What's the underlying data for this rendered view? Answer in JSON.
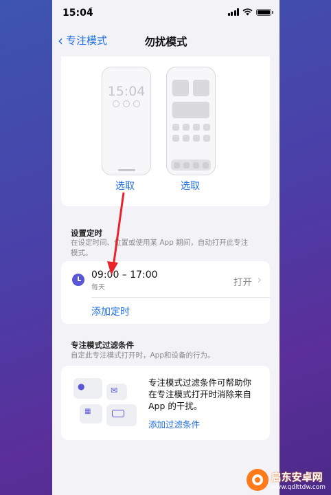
{
  "status_bar": {
    "time": "15:04",
    "moon": "☾"
  },
  "nav": {
    "back_label": "专注模式",
    "title": "勿扰模式"
  },
  "screens": {
    "lock_time": "15:04",
    "lock_pick_label": "选取",
    "home_pick_label": "选取"
  },
  "schedule": {
    "header": "设置定时",
    "description": "在设定时间、位置或使用某 App 期间，自动打开此专注模式。",
    "item_time": "09:00 – 17:00",
    "item_repeat": "每天",
    "item_status": "打开",
    "add_label": "添加定时"
  },
  "filters": {
    "header": "专注模式过滤条件",
    "description": "自定此专注模式打开时，App和设备的行为。",
    "body": "专注模式过滤条件可帮助你在专注模式打开时消除来自 App 的干扰。",
    "add_label": "添加过滤条件"
  },
  "watermark": {
    "title": "启东安卓网",
    "url": "www.qdlttdw.com"
  },
  "colors": {
    "accent": "#1f6fe0",
    "schedule_icon": "#5856d6",
    "arrow": "#e8232a",
    "watermark": "#ff7a1a"
  }
}
